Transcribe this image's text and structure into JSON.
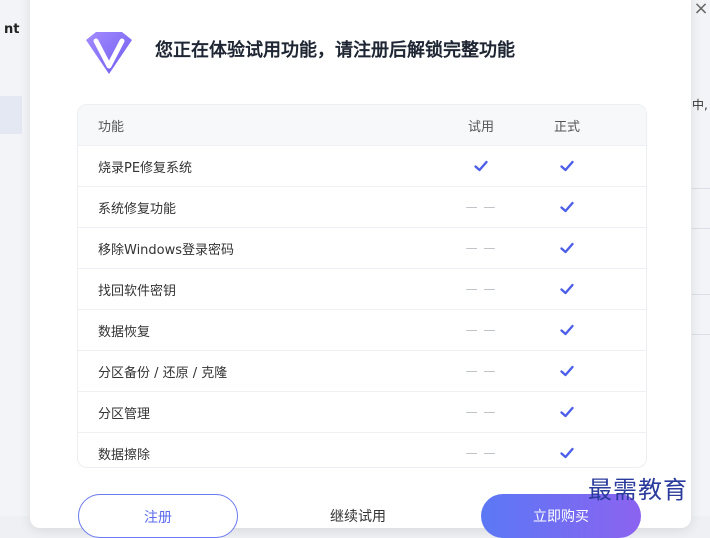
{
  "background": {
    "left_text": "nt",
    "right_text": "中,"
  },
  "dialog": {
    "close_label": "×",
    "title": "您正在体验试用功能，请注册后解锁完整功能",
    "table": {
      "headers": [
        "功能",
        "试用",
        "正式"
      ],
      "rows": [
        {
          "name": "烧录PE修复系统",
          "trial": true,
          "full": true
        },
        {
          "name": "系统修复功能",
          "trial": false,
          "full": true
        },
        {
          "name": "移除Windows登录密码",
          "trial": false,
          "full": true
        },
        {
          "name": "找回软件密钥",
          "trial": false,
          "full": true
        },
        {
          "name": "数据恢复",
          "trial": false,
          "full": true
        },
        {
          "name": "分区备份 / 还原 / 克隆",
          "trial": false,
          "full": true
        },
        {
          "name": "分区管理",
          "trial": false,
          "full": true
        },
        {
          "name": "数据擦除",
          "trial": false,
          "full": true
        }
      ],
      "dash_text": "— —"
    },
    "buttons": {
      "register": "注册",
      "continue_trial": "继续试用",
      "buy_now": "立即购买"
    }
  },
  "watermark": "最需教育",
  "colors": {
    "accent": "#5b6bec",
    "check": "#4d5fe8",
    "buy_gradient_start": "#5b78f5",
    "buy_gradient_end": "#8b63f0"
  }
}
